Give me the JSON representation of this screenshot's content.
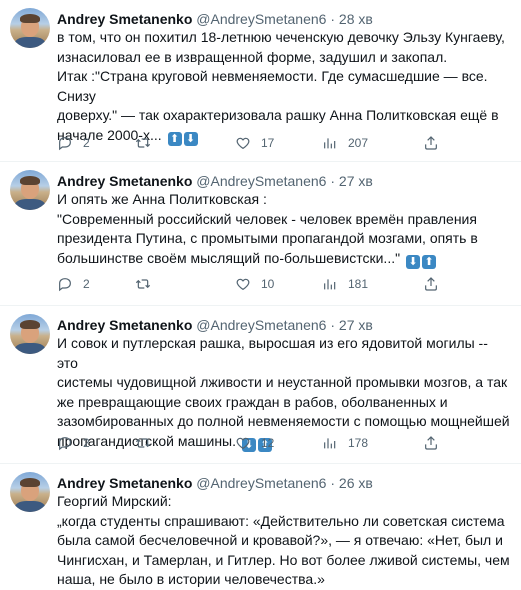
{
  "tweets": [
    {
      "author": {
        "name": "Andrey Smetanenko",
        "handle": "@AndreySmetanen6",
        "avatar": "profile-photo"
      },
      "separator": "·",
      "time": "28 хв",
      "lines": [
        "в том, что он похитил 18-летнюю чеченскую девочку Эльзу Кунгаеву,",
        "изнасиловал ее в извращенной форме, задушил и закопал.",
        "Итак :\"Страна круговой невменяемости. Где сумасшедшие — все. Снизу",
        "доверху.\" — так охарактеризовала рашку Анна Политковская ещё в",
        "начале 2000-х..."
      ],
      "emojis": [
        "⬆",
        "⬇"
      ],
      "stats": {
        "replies": "2",
        "retweets": "",
        "likes": "17",
        "views": "207"
      }
    },
    {
      "author": {
        "name": "Andrey Smetanenko",
        "handle": "@AndreySmetanen6",
        "avatar": "profile-photo"
      },
      "separator": "·",
      "time": "27 хв",
      "lines": [
        "И опять же Анна Политковская :",
        "\"Современный российский человек - человек времён правления",
        "президента Путина, с промытыми пропагандой мозгами, опять в",
        "большинстве своём мыслящий по-большевистски...\""
      ],
      "emojis": [
        "⬇",
        "⬆"
      ],
      "stats": {
        "replies": "2",
        "retweets": "",
        "likes": "10",
        "views": "181"
      }
    },
    {
      "author": {
        "name": "Andrey Smetanenko",
        "handle": "@AndreySmetanen6",
        "avatar": "profile-photo"
      },
      "separator": "·",
      "time": "27 хв",
      "lines": [
        "И совок и путлерская рашка, выросшая из его ядовитой могилы -- это",
        "системы чудовищной лживости и неустанной промывки мозгов, а так",
        "же превращающие своих граждан в рабов, оболваненных и",
        "зазомбированных до полной невменяемости с помощью мощнейшей",
        "пропагандистской машины."
      ],
      "emojis": [
        "⬇",
        "⬆"
      ],
      "stats": {
        "replies": "2",
        "retweets": "",
        "likes": "12",
        "views": "178"
      }
    },
    {
      "author": {
        "name": "Andrey Smetanenko",
        "handle": "@AndreySmetanen6",
        "avatar": "profile-photo"
      },
      "separator": "·",
      "time": "26 хв",
      "lines": [
        "Георгий Мирский:",
        "„когда студенты спрашивают: «Действительно ли советская система",
        "была самой бесчеловечной и кровавой?», — я отвечаю: «Нет, был и",
        "Чингисхан, и Тамерлан, и Гитлер. Но вот более лживой системы, чем",
        "наша, не было в истории человечества.»"
      ],
      "emojis": [],
      "stats": null
    }
  ]
}
